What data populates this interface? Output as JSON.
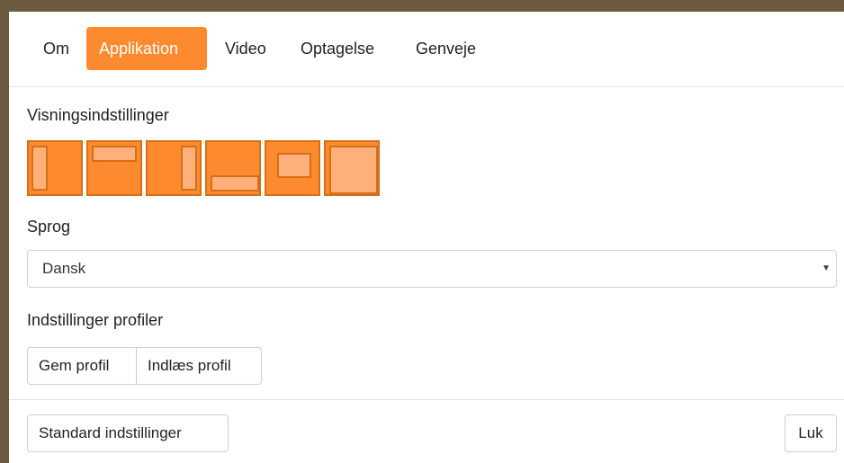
{
  "tabs": [
    {
      "label": "Om"
    },
    {
      "label": "Applikation"
    },
    {
      "label": "Video"
    },
    {
      "label": "Optagelse"
    },
    {
      "label": "Genveje"
    }
  ],
  "active_tab": "Applikation",
  "display_settings": {
    "label": "Visningsindstillinger",
    "layouts": [
      "layout-left-icon",
      "layout-top-icon",
      "layout-right-icon",
      "layout-bottom-icon",
      "layout-center-icon",
      "layout-full-icon"
    ]
  },
  "language": {
    "label": "Sprog",
    "selected": "Dansk"
  },
  "profiles": {
    "label": "Indstillinger profiler",
    "save_label": "Gem profil",
    "load_label": "Indlæs profil"
  },
  "footer": {
    "defaults_label": "Standard indstillinger",
    "close_label": "Luk"
  },
  "colors": {
    "accent": "#fd8a2e",
    "accent_border": "#d66f17",
    "accent_light": "#fdb07a"
  }
}
